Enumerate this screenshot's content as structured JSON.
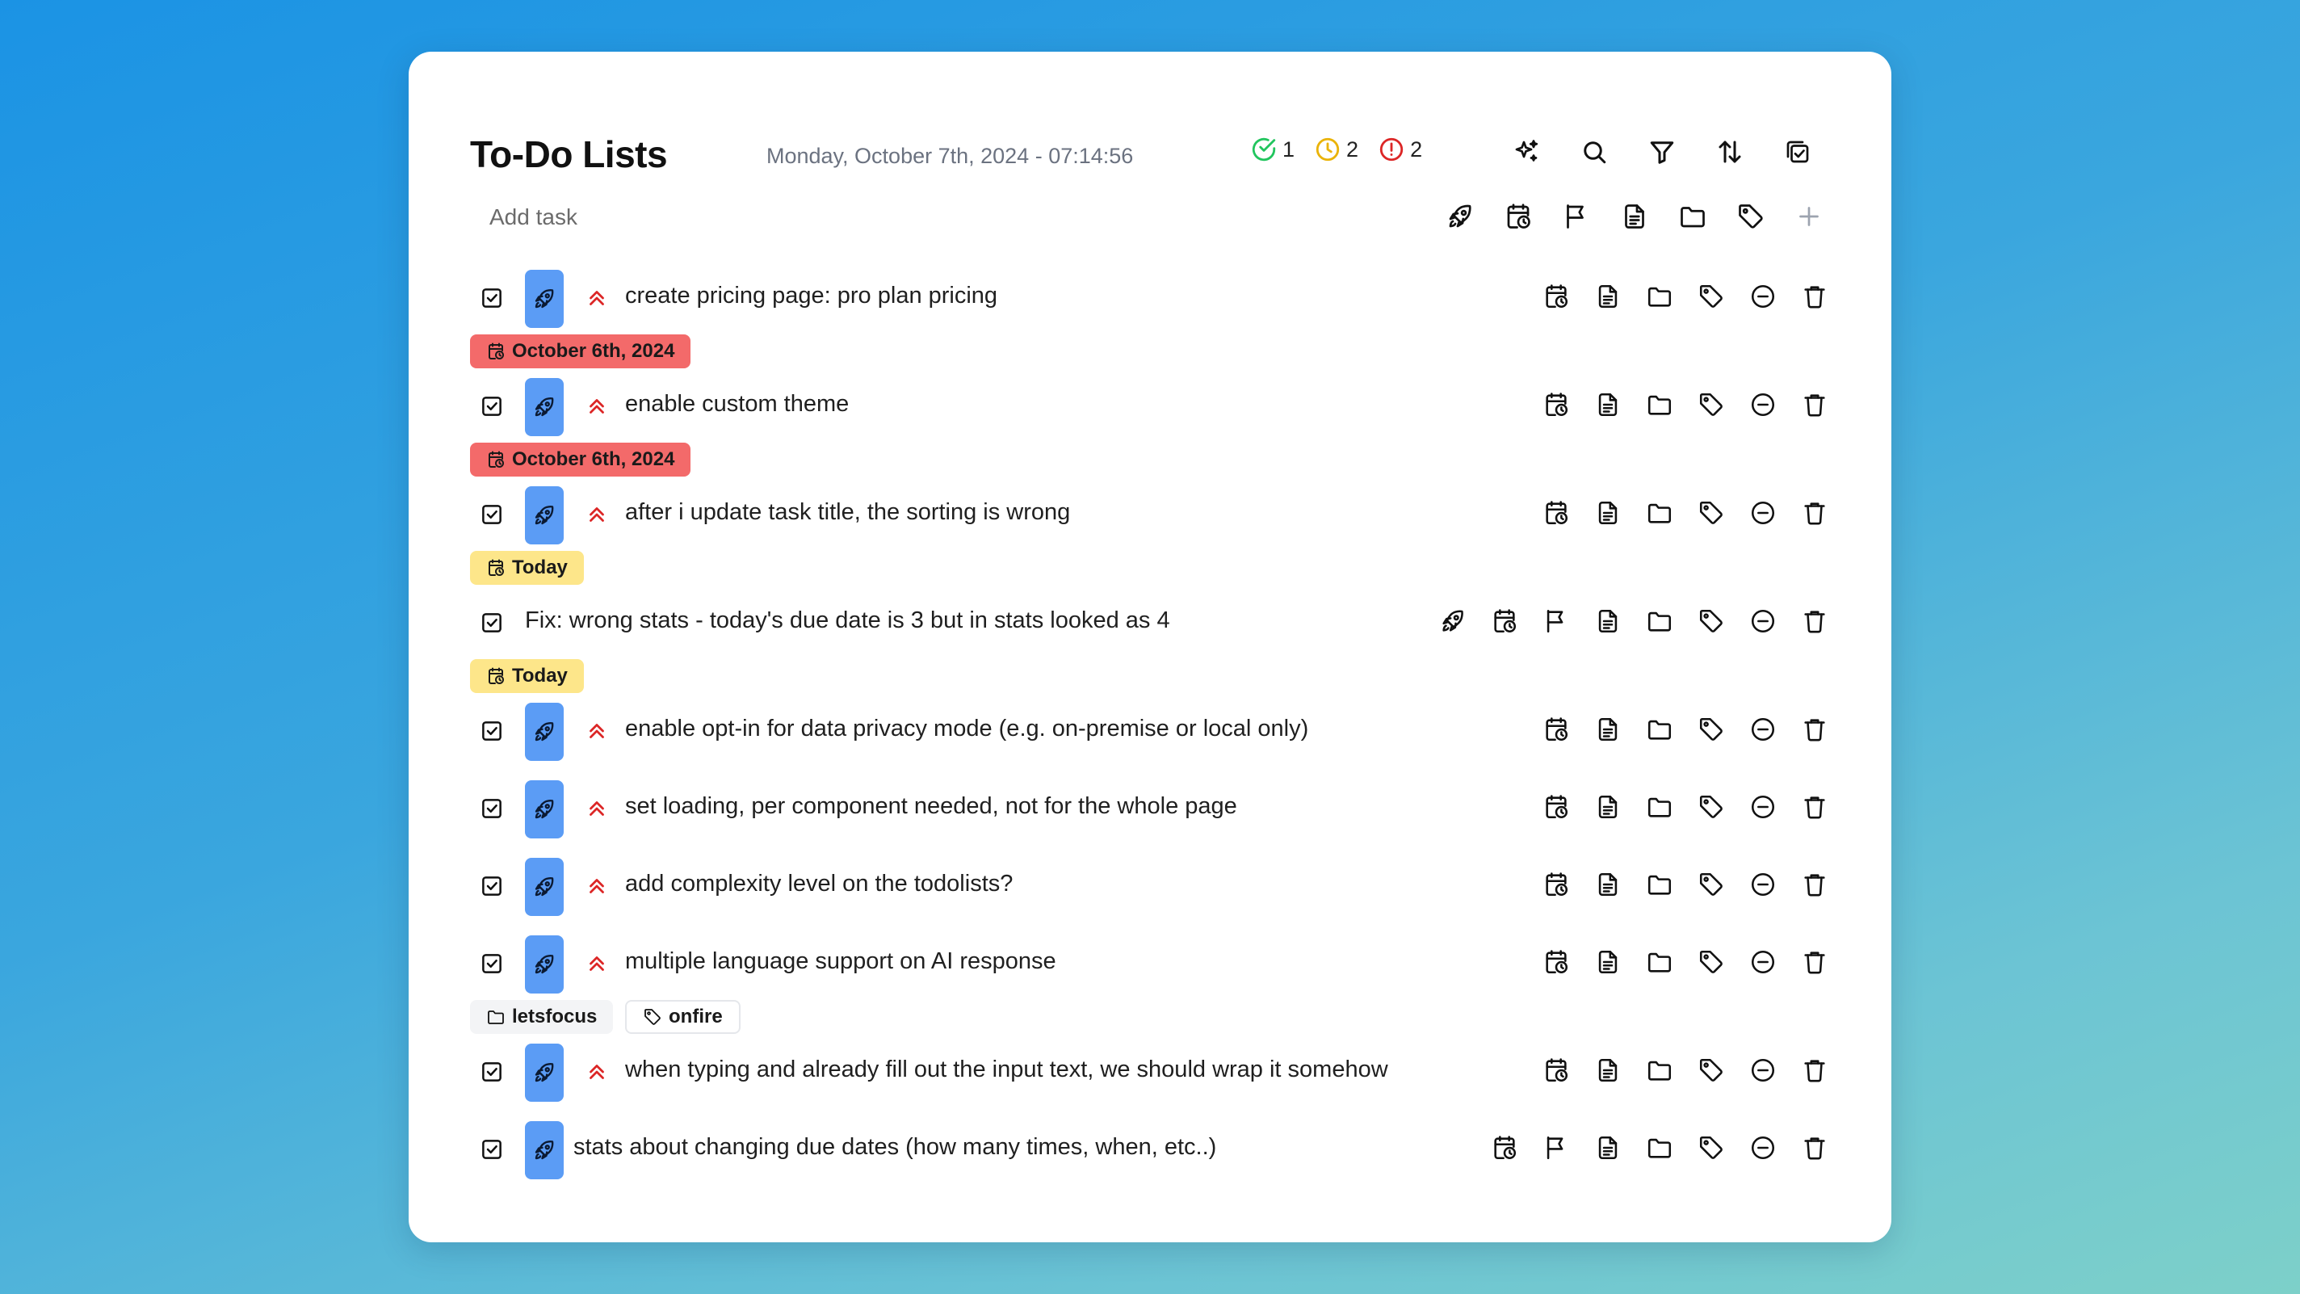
{
  "app": {
    "title": "To-Do Lists",
    "datetime": "Monday, October 7th, 2024 - 07:14:56"
  },
  "stats": {
    "done": "1",
    "pending": "2",
    "overdue": "2",
    "colors": {
      "done": "#22c55e",
      "pending": "#eab308",
      "overdue": "#dc2626"
    }
  },
  "header_tools": [
    "sparkles-icon",
    "search-icon",
    "filter-icon",
    "sort-icon",
    "copy-check-icon"
  ],
  "add_task": {
    "placeholder": "Add task",
    "tools": [
      "rocket-icon",
      "calendar-clock-icon",
      "flag-icon",
      "document-icon",
      "folder-icon",
      "tag-icon",
      "plus-icon"
    ]
  },
  "tasks": [
    {
      "text": "create pricing page: pro plan pricing",
      "rocket": true,
      "priority": true,
      "due": "October 6th, 2024",
      "due_status": "overdue"
    },
    {
      "text": "enable custom theme",
      "rocket": true,
      "priority": true,
      "due": "October 6th, 2024",
      "due_status": "overdue"
    },
    {
      "text": "after i update task title, the sorting is wrong",
      "rocket": true,
      "priority": true,
      "due": "Today",
      "due_status": "today"
    },
    {
      "text": "Fix: wrong stats - today's due date is 3 but in stats looked as 4",
      "rocket": false,
      "priority": false,
      "due": "Today",
      "due_status": "today"
    },
    {
      "text": "enable opt-in for data privacy mode (e.g. on-premise or local only)",
      "rocket": true,
      "priority": true
    },
    {
      "text": "set loading, per component needed, not for the whole page",
      "rocket": true,
      "priority": true
    },
    {
      "text": "add complexity level on the todolists?",
      "rocket": true,
      "priority": true
    },
    {
      "text": "multiple language support on AI response",
      "rocket": true,
      "priority": true,
      "folder": "letsfocus",
      "tag": "onfire"
    },
    {
      "text": "when typing and already fill out the input text, we should wrap it somehow",
      "rocket": true,
      "priority": true
    },
    {
      "text": "stats about changing due dates (how many times, when, etc..)",
      "rocket": true,
      "priority": false
    }
  ],
  "colors": {
    "overdue_chip": "#f36a6a",
    "today_chip": "#fde68a",
    "rocket_badge": "#5b9cf5",
    "priority": "#dc2626"
  }
}
